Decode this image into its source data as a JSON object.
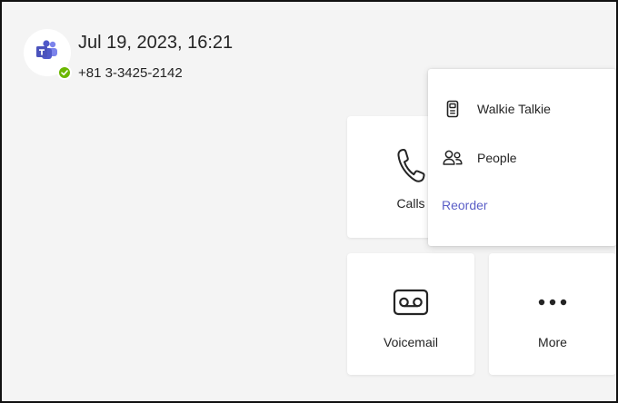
{
  "header": {
    "datetime": "Jul 19, 2023, 16:21",
    "phone_number": "+81 3-3425-2142",
    "avatar_icon": "teams-logo-icon",
    "status_icon": "available-check-icon",
    "status_color": "#6bb700"
  },
  "tiles": {
    "calls": {
      "label": "Calls",
      "icon": "phone-icon"
    },
    "voicemail": {
      "label": "Voicemail",
      "icon": "voicemail-icon"
    },
    "more": {
      "label": "More",
      "icon": "more-dots-icon"
    }
  },
  "menu": {
    "items": [
      {
        "label": "Walkie Talkie",
        "icon": "walkie-talkie-icon"
      },
      {
        "label": "People",
        "icon": "people-icon"
      }
    ],
    "reorder_label": "Reorder",
    "accent_color": "#5b5fc7"
  }
}
